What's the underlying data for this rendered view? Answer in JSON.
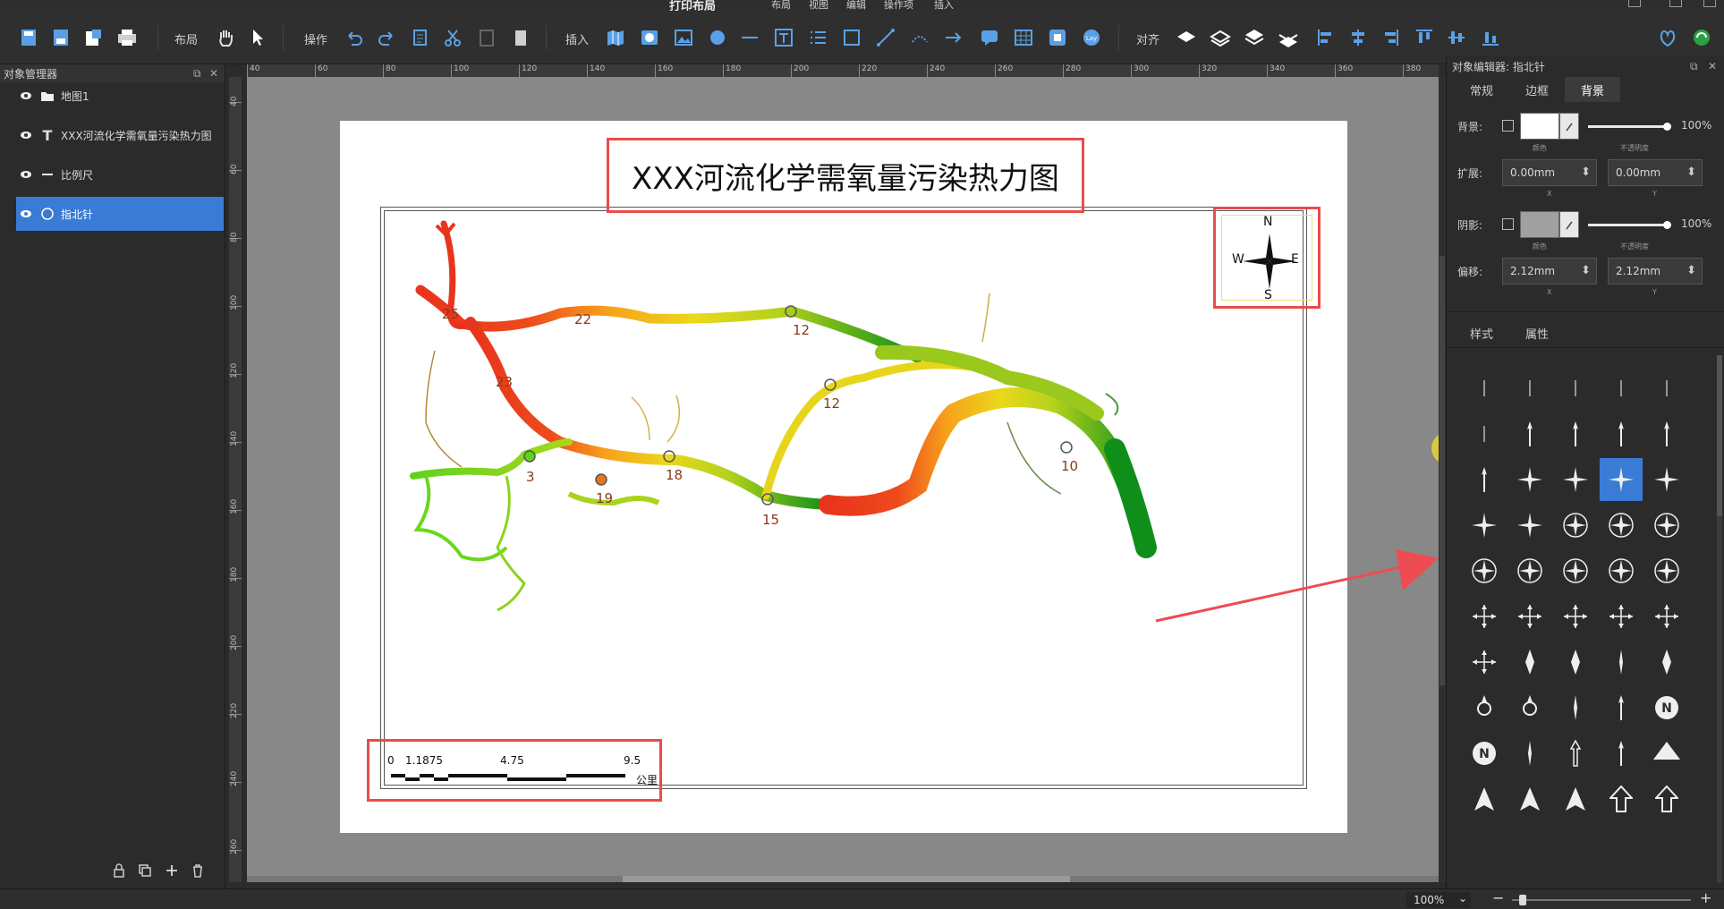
{
  "app": {
    "title": "打印布局",
    "menus": [
      "布局",
      "视图",
      "编辑",
      "操作项",
      "插入"
    ]
  },
  "toolbar": {
    "layout_label": "布局",
    "operate_label": "操作",
    "insert_label": "插入",
    "align_label": "对齐"
  },
  "object_manager": {
    "title": "对象管理器",
    "layers": [
      {
        "icon": "folder-icon",
        "label": "地图1"
      },
      {
        "icon": "text-icon",
        "label": "XXX河流化学需氧量污染热力图"
      },
      {
        "icon": "scale-bar-icon",
        "label": "比例尺"
      },
      {
        "icon": "compass-icon",
        "label": "指北针",
        "selected": true
      }
    ]
  },
  "ruler": {
    "h_ticks": [
      "40",
      "60",
      "80",
      "100",
      "120",
      "140",
      "160",
      "180",
      "200",
      "220",
      "240",
      "260",
      "280",
      "300",
      "320",
      "340",
      "360",
      "380"
    ],
    "v_ticks": [
      "40",
      "60",
      "80",
      "100",
      "120",
      "140",
      "160",
      "180",
      "200",
      "220",
      "240",
      "260"
    ]
  },
  "layout_page": {
    "map_title": "XXX河流化学需氧量污染热力图",
    "compass": {
      "n": "N",
      "s": "S",
      "e": "E",
      "w": "W"
    },
    "scale_bar": {
      "labels": [
        "0",
        "1.1875",
        "4.75",
        "9.5"
      ],
      "unit": "公里"
    },
    "stations": [
      "25",
      "22",
      "12",
      "23",
      "12",
      "3",
      "18",
      "19",
      "15",
      "10"
    ],
    "colors": {
      "high": "#e8341c",
      "mid": "#f7a21b",
      "low": "#e9dd1a",
      "clean": "#1e9a1e",
      "highlight_border": "#e84c4c"
    }
  },
  "object_editor": {
    "title": "对象编辑器: 指北针",
    "tabs": [
      "常规",
      "边框",
      "背景"
    ],
    "active_tab": "背景",
    "background": {
      "label": "背景:",
      "color_sub": "颜色",
      "opacity": "100%",
      "opacity_sub": "不透明度"
    },
    "expand": {
      "label": "扩展:",
      "x": "0.00mm",
      "y": "0.00mm",
      "x_sub": "X",
      "y_sub": "Y"
    },
    "shadow": {
      "label": "阴影:",
      "color_sub": "颜色",
      "opacity": "100%",
      "opacity_sub": "不透明度"
    },
    "offset": {
      "label": "偏移:",
      "x": "2.12mm",
      "y": "2.12mm",
      "x_sub": "X",
      "y_sub": "Y"
    },
    "style_tabs": [
      "样式",
      "属性"
    ],
    "active_style_tab": "样式"
  },
  "statusbar": {
    "zoom": "100%"
  }
}
